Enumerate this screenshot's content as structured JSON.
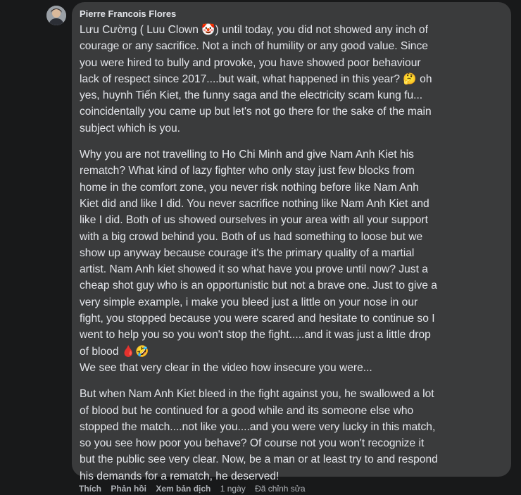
{
  "comment": {
    "author": "Pierre Francois Flores",
    "paragraphs": [
      [
        "Lưu Cường ( Luu Clown 🤡) until today, you did not showed any inch of",
        "courage or any sacrifice. Not a inch of humility or any good value. Since",
        "you were hired to bully and provoke, you have showed poor behaviour",
        "lack of respect since 2017....but wait, what happened in this year? 🤔 oh",
        "yes, huynh Tiến Kiet, the funny saga and the electricity scam kung fu...",
        "coincidentally you came up but let's not go there for the sake of the main",
        "subject which is you."
      ],
      [
        "Why you are not travelling to Ho Chi Minh and give Nam Anh Kiet his",
        "rematch? What kind of lazy fighter who only stay just few blocks from",
        "home in the comfort zone, you never risk nothing before like Nam Anh",
        "Kiet did and like I did. You never sacrifice nothing like Nam Anh Kiet and",
        "like I did. Both of us showed ourselves in your area with all your support",
        "with a big crowd behind you. Both of us had something to loose but we",
        "show up anyway because courage it's the primary quality of a martial",
        "artist. Nam Anh kiet showed it so what have you prove until now? Just a",
        "cheap shot guy who is an opportunistic but not a brave one. Just to give a",
        "very simple example, i make you bleed just a little on your nose in our",
        "fight, you stopped because you were scared and hesitate to continue so I",
        "went to help you so you won't stop the fight.....and it was just a little drop",
        "of blood 🩸🤣",
        "We see that very clear in the video how insecure you were..."
      ],
      [
        "But when Nam Anh Kiet bleed in the fight against you, he swallowed a lot",
        "of blood but he continued for a good while and its someone else who",
        "stopped the match....not like you....and you were very lucky in this match,",
        "so you see how poor you behave? Of course not you won't recognize it",
        "but the public see very clear. Now, be a man or at least try to and respond",
        "his demands for a rematch, he deserved!"
      ]
    ]
  },
  "actions": {
    "like": "Thích",
    "reply": "Phản hồi",
    "translate": "Xem bản dịch",
    "time": "1 ngày",
    "edited": "Đã chỉnh sửa"
  }
}
